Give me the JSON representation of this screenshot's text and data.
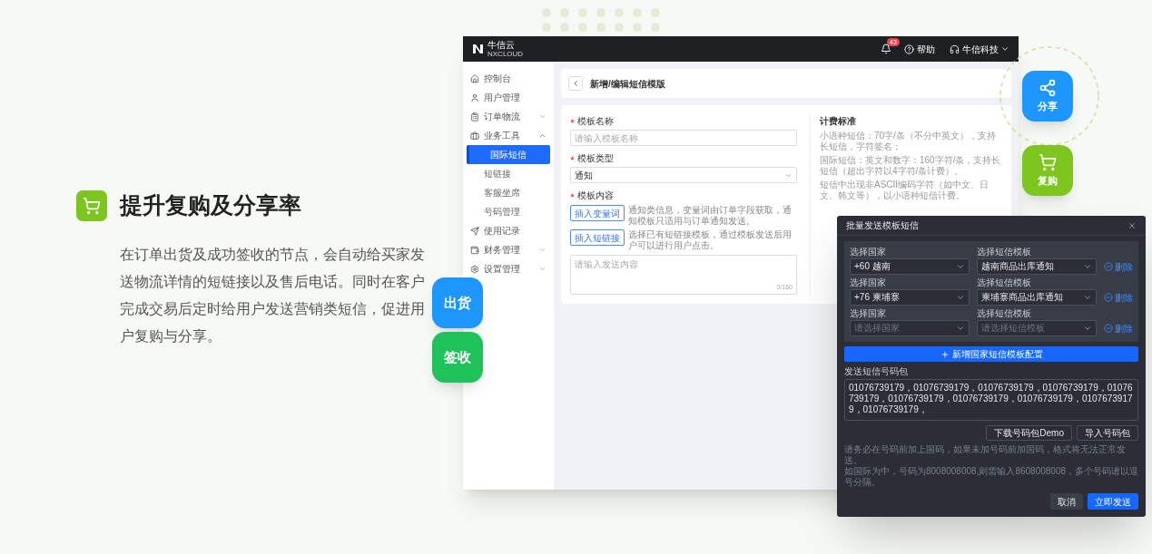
{
  "feature": {
    "title": "提升复购及分享率",
    "description": "在订单出货及成功签收的节点，会自动给买家发送物流详情的短链接以及售后电话。同时在客户完成交易后定时给用户发送营销类短信，促进用户复购与分享。"
  },
  "badges": [
    {
      "label": "分享",
      "kind": "share",
      "color": "#1e96ff"
    },
    {
      "label": "复购",
      "kind": "cart",
      "color": "#7cc61f"
    },
    {
      "label": "出货",
      "kind": "text",
      "color": "#1e96ff"
    },
    {
      "label": "签收",
      "kind": "text",
      "color": "#1fc15a"
    }
  ],
  "app": {
    "logo": {
      "name": "牛信云",
      "subtitle": "NXCLOUD"
    },
    "notifications": "43",
    "help": "帮助",
    "account": "牛信科技",
    "sidebar": [
      {
        "label": "控制台",
        "kind": "home",
        "selected": false
      },
      {
        "label": "用户管理",
        "kind": "user",
        "selected": false
      },
      {
        "label": "订单物流",
        "kind": "list",
        "selected": false,
        "expanded": false
      },
      {
        "label": "业务工具",
        "kind": "tools",
        "selected": false,
        "expanded": true,
        "children": [
          {
            "label": "国际短信",
            "selected": true
          },
          {
            "label": "短链接",
            "selected": false
          },
          {
            "label": "客服坐席",
            "selected": false
          },
          {
            "label": "号码管理",
            "selected": false
          }
        ]
      },
      {
        "label": "使用记录",
        "kind": "send",
        "selected": false
      },
      {
        "label": "财务管理",
        "kind": "wallet",
        "selected": false,
        "expanded": false
      },
      {
        "label": "设置管理",
        "kind": "gear",
        "selected": false,
        "expanded": false
      }
    ],
    "page_title": "新增/编辑短信模版",
    "form": {
      "name": {
        "label": "模板名称",
        "required": true,
        "placeholder": "请输入模板名称"
      },
      "type": {
        "label": "模板类型",
        "required": true,
        "value": "通知"
      },
      "content": {
        "label": "模板内容",
        "required": true,
        "inserts": [
          {
            "button": "插入变量词",
            "hint": "通知类信息，变量词由订单字段获取，通知模板只适用与订单通知发送。"
          },
          {
            "button": "插入短链接",
            "hint": "选择已有短链接模板，通过模板发送后用户可以进行用户点击。"
          }
        ],
        "placeholder": "请输入发送内容",
        "counter": "0/160"
      }
    },
    "billing": {
      "title": "计费标准",
      "paragraphs": [
        "小语种短信：70字/条（不分中英文），支持长短信，字符签名；",
        "国际短信：英文和数字：160字符/条，支持长短信（超出字符以4字符/条计费）。",
        "短信中出现非ASCII编码字符（如中文、日文、韩文等），以小语种短信计费。"
      ]
    }
  },
  "dialog": {
    "title": "批量发送模板短信",
    "rows": [
      {
        "country": {
          "label": "选择国家",
          "value": "+60 越南"
        },
        "template": {
          "label": "选择短信模板",
          "value": "越南商品出库通知"
        },
        "remove": "删除"
      },
      {
        "country": {
          "label": "选择国家",
          "value": "+76 柬埔寨"
        },
        "template": {
          "label": "选择短信模板",
          "value": "柬埔寨商品出库通知"
        },
        "remove": "删除"
      },
      {
        "country": {
          "label": "选择国家",
          "placeholder": "请选择国家"
        },
        "template": {
          "label": "选择短信模板",
          "placeholder": "请选择短信模板"
        },
        "remove": "删除"
      }
    ],
    "add_button": "新增国家短信模板配置",
    "numbers_label": "发送短信号码包",
    "numbers": "01076739179，01076739179，01076739179，01076739179，01076739179，01076739179，01076739179，01076739179，01076739179，01076739179，",
    "download_button": "下载号码包Demo",
    "import_button": "导入号码包",
    "notes": [
      "请务必在号码前加上国码，如果未加号码前加国码，格式将无法正常发送。",
      "如国际为中，号码为8008008008,则需输入8608008008，多个号码请以逗号分隔。"
    ],
    "cancel": "取消",
    "submit": "立即发送"
  }
}
